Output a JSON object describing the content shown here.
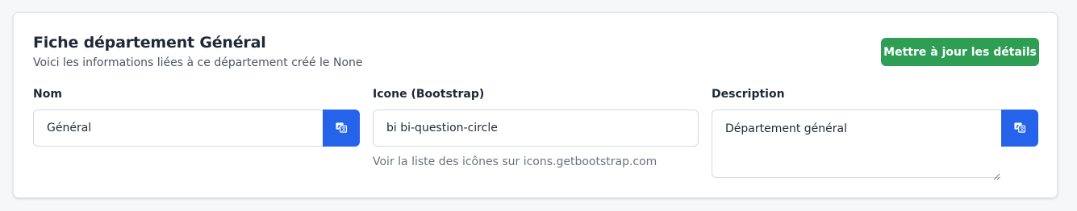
{
  "header": {
    "title": "Fiche département Général",
    "subtitle": "Voici les informations liées à ce département créé le None",
    "update_label": "Mettre à jour les détails"
  },
  "fields": {
    "nom": {
      "label": "Nom",
      "value": "Général"
    },
    "icone": {
      "label": "Icone (Bootstrap)",
      "value": "bi bi-question-circle",
      "help": "Voir la liste des icônes sur icons.getbootstrap.com"
    },
    "description": {
      "label": "Description",
      "value": "Département général"
    }
  },
  "icons": {
    "translate": "translate-icon"
  },
  "colors": {
    "update_button": "#2f9e55",
    "translate_button": "#2563eb"
  }
}
